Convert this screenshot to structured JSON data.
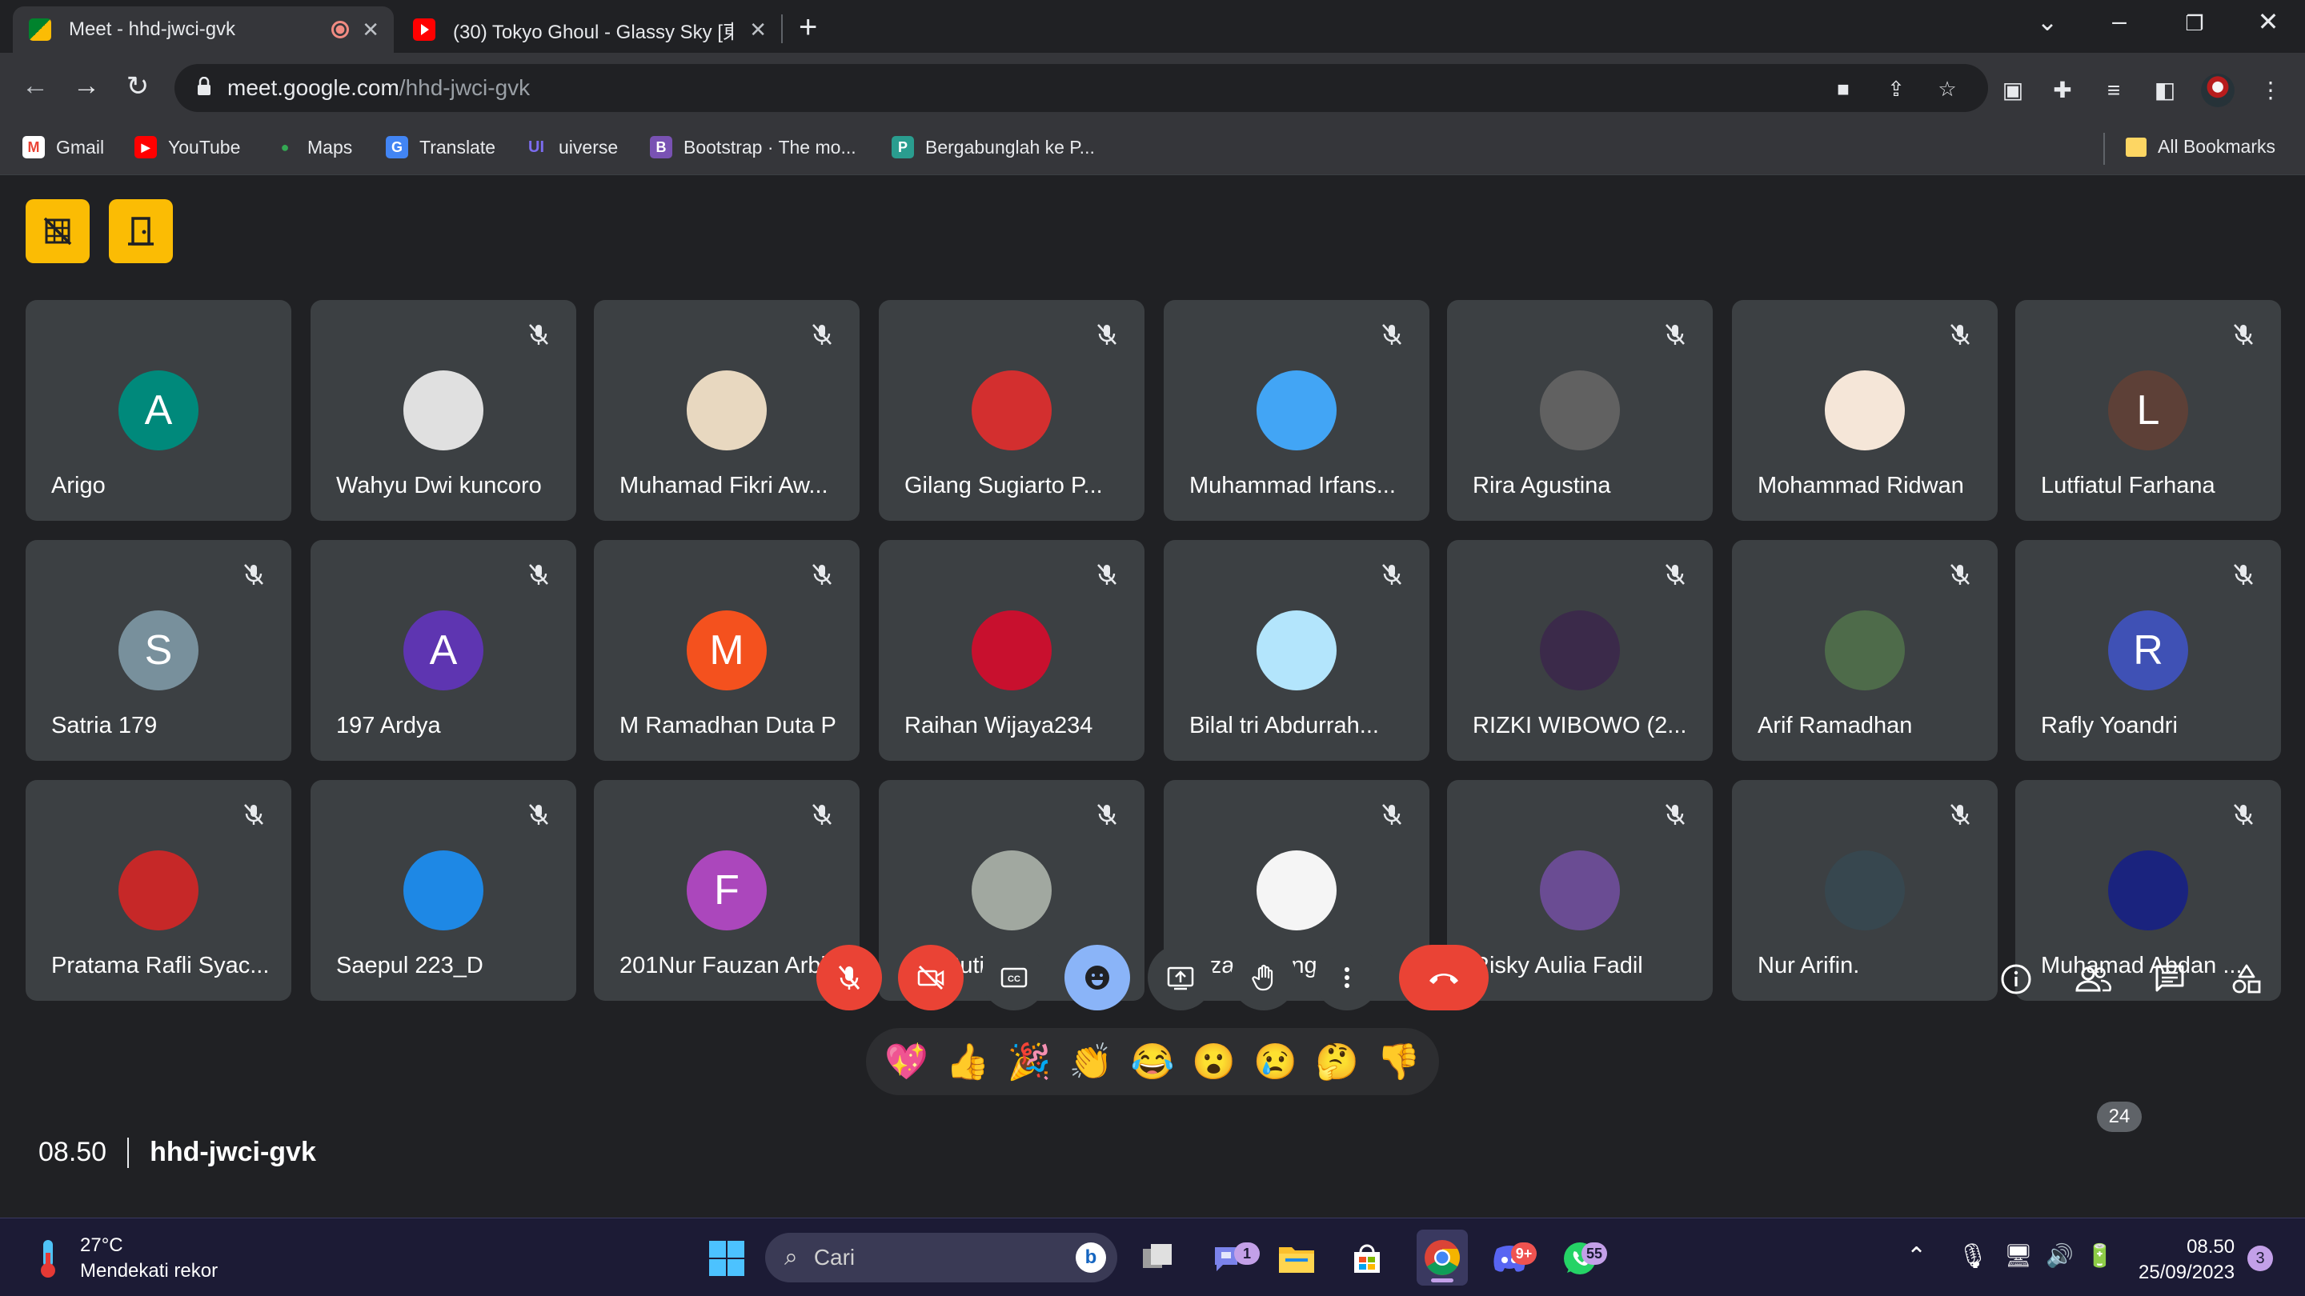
{
  "browser": {
    "tabs": [
      {
        "title": "Meet - hhd-jwci-gvk",
        "active": true
      },
      {
        "title": "(30) Tokyo Ghoul - Glassy Sky [東",
        "active": false
      }
    ],
    "url_domain": "meet.google.com",
    "url_path": "/hhd-jwci-gvk",
    "bookmarks": [
      {
        "label": "Gmail",
        "icon": "gmail-icon",
        "color": "#ea4335",
        "glyph": "M"
      },
      {
        "label": "YouTube",
        "icon": "youtube-icon",
        "color": "#ff0000",
        "glyph": "▶"
      },
      {
        "label": "Maps",
        "icon": "maps-icon",
        "color": "#34a853",
        "glyph": "●"
      },
      {
        "label": "Translate",
        "icon": "translate-icon",
        "color": "#4285f4",
        "glyph": "G"
      },
      {
        "label": "uiverse",
        "icon": "uiverse-icon",
        "color": "#6b4ce6",
        "glyph": "UI"
      },
      {
        "label": "Bootstrap · The mo...",
        "icon": "bootstrap-icon",
        "color": "#7952b3",
        "glyph": "B"
      },
      {
        "label": "Bergabunglah ke P...",
        "icon": "padlet-icon",
        "color": "#2a9d8f",
        "glyph": "P"
      }
    ],
    "all_bookmarks": "All Bookmarks"
  },
  "meeting": {
    "time": "08.50",
    "code": "hhd-jwci-gvk",
    "participant_count": "24",
    "participants": [
      {
        "name": "Arigo",
        "initial": "A",
        "color": "#00897b",
        "muted": false
      },
      {
        "name": "Wahyu Dwi kuncoro",
        "initial": "",
        "color": "#e0e0e0",
        "muted": true
      },
      {
        "name": "Muhamad Fikri Aw...",
        "initial": "",
        "color": "#e8d8c0",
        "muted": true
      },
      {
        "name": "Gilang Sugiarto P...",
        "initial": "",
        "color": "#d32f2f",
        "muted": true
      },
      {
        "name": "Muhammad Irfans...",
        "initial": "",
        "color": "#42a5f5",
        "muted": true
      },
      {
        "name": "Rira Agustina",
        "initial": "",
        "color": "#616161",
        "muted": true
      },
      {
        "name": "Mohammad Ridwan",
        "initial": "",
        "color": "#f5e6d8",
        "muted": true
      },
      {
        "name": "Lutfiatul Farhana",
        "initial": "L",
        "color": "#5d4037",
        "muted": true
      },
      {
        "name": "Satria 179",
        "initial": "S",
        "color": "#78909c",
        "muted": true
      },
      {
        "name": "197 Ardya",
        "initial": "A",
        "color": "#5e35b1",
        "muted": true
      },
      {
        "name": "M Ramadhan Duta P",
        "initial": "M",
        "color": "#f4511e",
        "muted": true
      },
      {
        "name": "Raihan Wijaya234",
        "initial": "",
        "color": "#c8102e",
        "muted": true
      },
      {
        "name": "Bilal tri Abdurrah...",
        "initial": "",
        "color": "#b3e5fc",
        "muted": true
      },
      {
        "name": "RIZKI WIBOWO (2...",
        "initial": "",
        "color": "#3b2a4a",
        "muted": true
      },
      {
        "name": "Arif Ramadhan",
        "initial": "",
        "color": "#4e6b4a",
        "muted": true
      },
      {
        "name": "Rafly Yoandri",
        "initial": "R",
        "color": "#3f51b5",
        "muted": true
      },
      {
        "name": "Pratama Rafli Syac...",
        "initial": "",
        "color": "#c62828",
        "muted": true
      },
      {
        "name": "Saepul 223_D",
        "initial": "",
        "color": "#1e88e5",
        "muted": true
      },
      {
        "name": "201Nur Fauzan Arbi",
        "initial": "F",
        "color": "#ab47bc",
        "muted": true
      },
      {
        "name": "Adi Sutisna",
        "initial": "",
        "color": "#a1a8a0",
        "muted": true
      },
      {
        "name": "reza tanjung",
        "initial": "",
        "color": "#f5f5f5",
        "muted": true
      },
      {
        "name": "Risky Aulia Fadil",
        "initial": "",
        "color": "#6a4c93",
        "muted": true
      },
      {
        "name": "Nur Arifin.",
        "initial": "",
        "color": "#37474f",
        "muted": true
      },
      {
        "name": "Muhamad Abdan ...",
        "initial": "",
        "color": "#1a237e",
        "muted": true
      }
    ],
    "reactions": [
      "💖",
      "👍",
      "🎉",
      "👏",
      "😂",
      "😮",
      "😢",
      "🤔",
      "👎"
    ]
  },
  "taskbar": {
    "temperature": "27°C",
    "weather_text": "Mendekati rekor",
    "search_placeholder": "Cari",
    "teams_badge": "1",
    "discord_badge": "9+",
    "whatsapp_badge": "55",
    "time": "08.50",
    "date": "25/09/2023",
    "notification_count": "3"
  }
}
